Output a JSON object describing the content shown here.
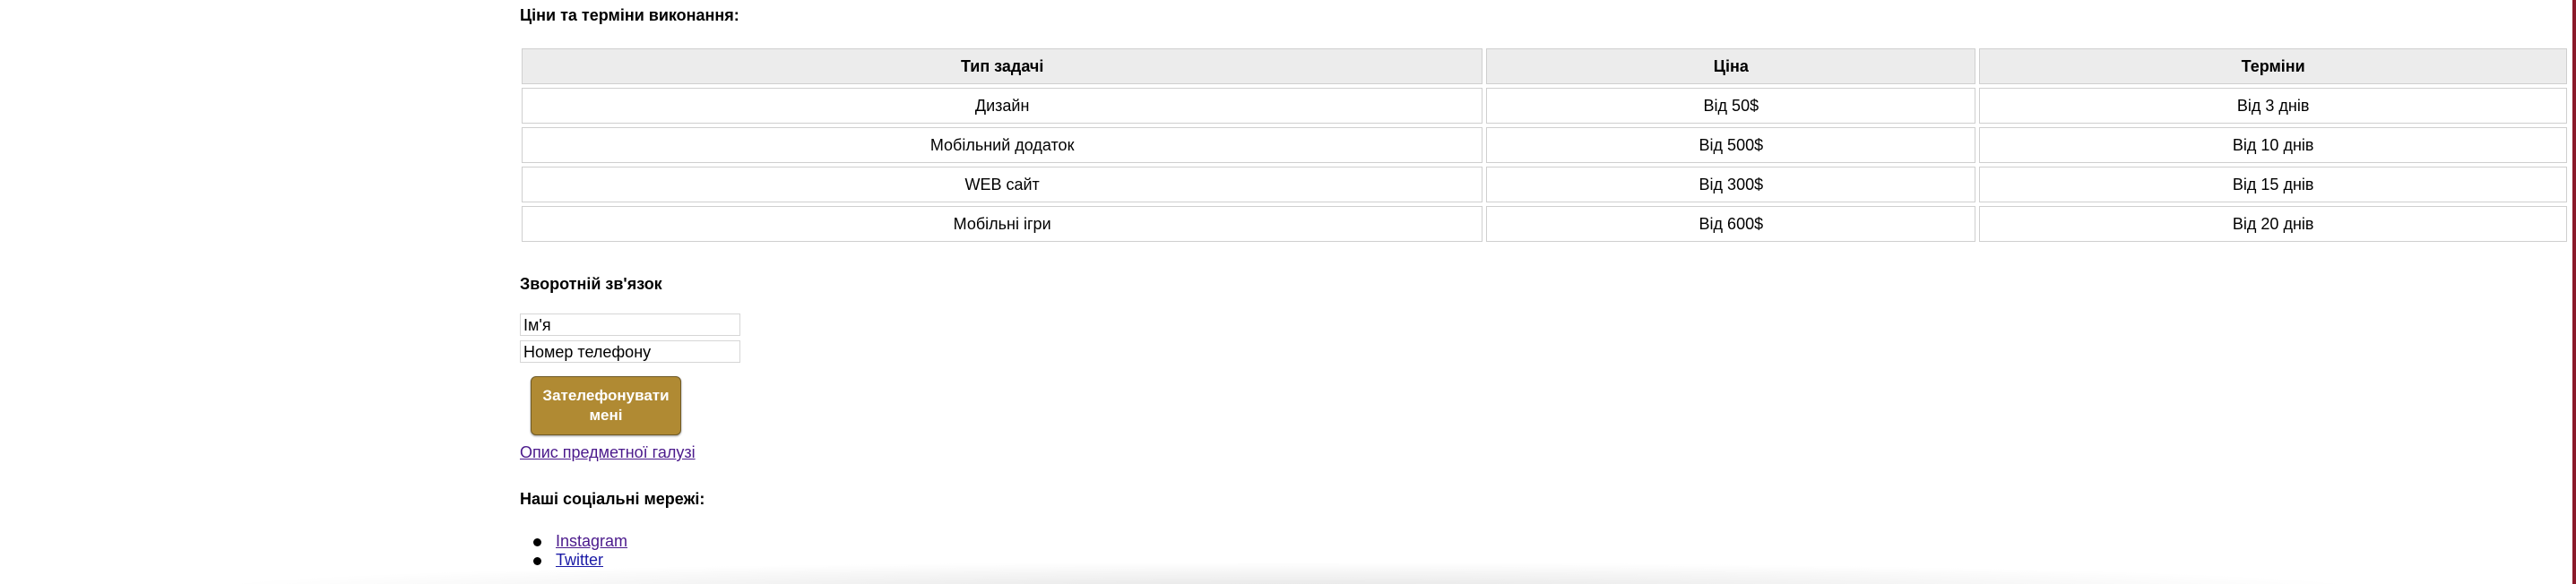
{
  "prices_section": {
    "heading": "Ціни та терміни виконання:",
    "columns": [
      "Тип задачі",
      "Ціна",
      "Терміни"
    ],
    "rows": [
      [
        "Дизайн",
        "Від 50$",
        "Від 3 днів"
      ],
      [
        "Мобільний додаток",
        "Від 500$",
        "Від 10 днів"
      ],
      [
        "WEB сайт",
        "Від 300$",
        "Від 15 днів"
      ],
      [
        "Мобільні ігри",
        "Від 600$",
        "Від 20 днів"
      ]
    ]
  },
  "feedback_section": {
    "heading": "Зворотній зв'язок",
    "name_placeholder": "Ім'я",
    "phone_placeholder": "Номер телефону",
    "call_button_label": "Зателефонувати мені",
    "button_color": "#b08a33"
  },
  "domain_link": "Опис предметної галузі",
  "social_section": {
    "heading": "Наші соціальні мережі:",
    "links": [
      "Instagram",
      "Twitter"
    ]
  },
  "colors": {
    "link_visited": "#4b1a8c",
    "link": "#1a1aa6",
    "table_header_bg": "#ececec"
  }
}
